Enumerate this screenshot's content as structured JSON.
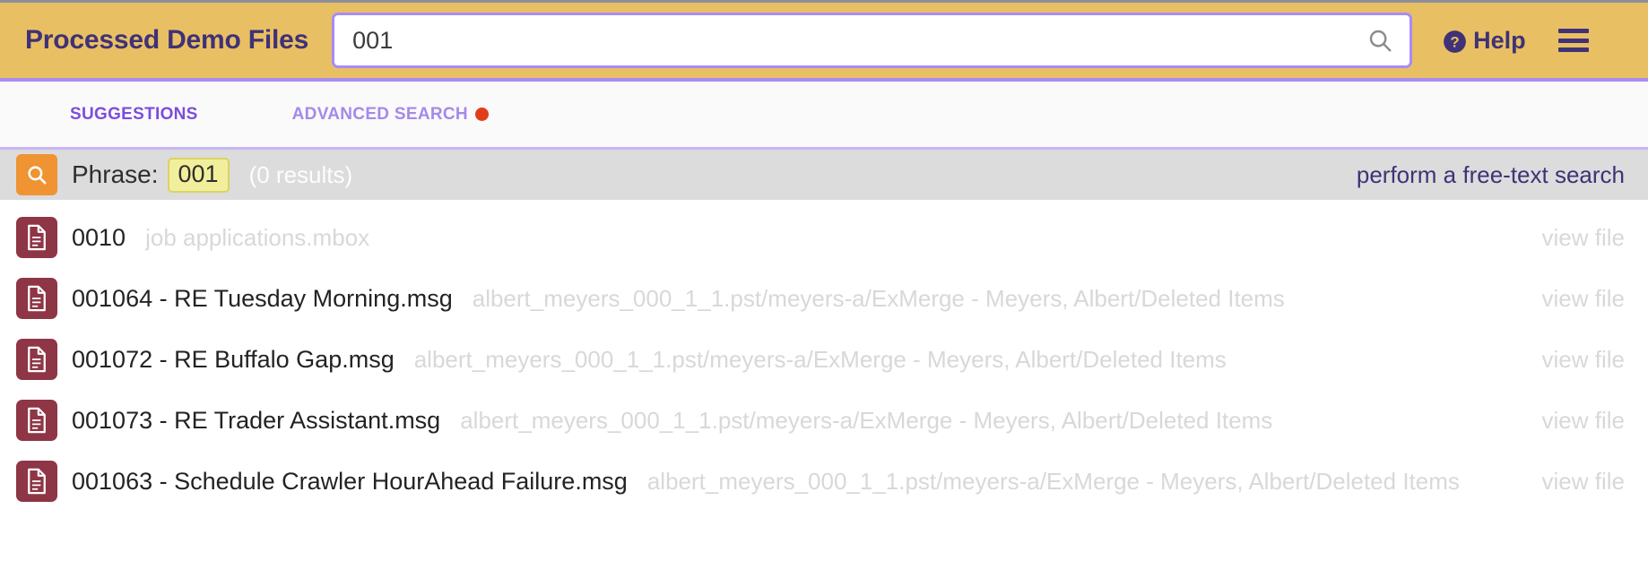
{
  "header": {
    "brand_title": "Processed Demo Files",
    "search": {
      "value": "001",
      "placeholder": "Search",
      "icon": "search-icon"
    },
    "help_label": "Help",
    "help_icon": "question-circle-icon",
    "menu_icon": "hamburger-menu-icon",
    "background_color": "#e9bf63",
    "title_color": "#3f3277",
    "input_border_color": "#a78bfa"
  },
  "tabs": [
    {
      "label": "SUGGESTIONS",
      "active": true,
      "badge": false
    },
    {
      "label": "ADVANCED SEARCH",
      "active": false,
      "badge": true,
      "badge_color": "#e03e1a"
    }
  ],
  "phrase_bar": {
    "search_icon": "search-icon",
    "search_button_color": "#ef9333",
    "label": "Phrase:",
    "phrase_value": "001",
    "phrase_chip_bg": "#f2ef9c",
    "results_count": "(0 results)",
    "free_text_link": "perform a free-text search",
    "background_color": "#dcdcdc"
  },
  "results": {
    "file_icon": "document-file-icon",
    "file_badge_color": "#8e3646",
    "view_file_label": "view file",
    "items": [
      {
        "title": "0010",
        "path": "job applications.mbox"
      },
      {
        "title": "001064 - RE Tuesday Morning.msg",
        "path": "albert_meyers_000_1_1.pst/meyers-a/ExMerge - Meyers, Albert/Deleted Items"
      },
      {
        "title": "001072 - RE Buffalo Gap.msg",
        "path": "albert_meyers_000_1_1.pst/meyers-a/ExMerge - Meyers, Albert/Deleted Items"
      },
      {
        "title": "001073 - RE Trader Assistant.msg",
        "path": "albert_meyers_000_1_1.pst/meyers-a/ExMerge - Meyers, Albert/Deleted Items"
      },
      {
        "title": "001063 - Schedule Crawler HourAhead Failure.msg",
        "path": "albert_meyers_000_1_1.pst/meyers-a/ExMerge - Meyers, Albert/Deleted Items"
      }
    ]
  }
}
